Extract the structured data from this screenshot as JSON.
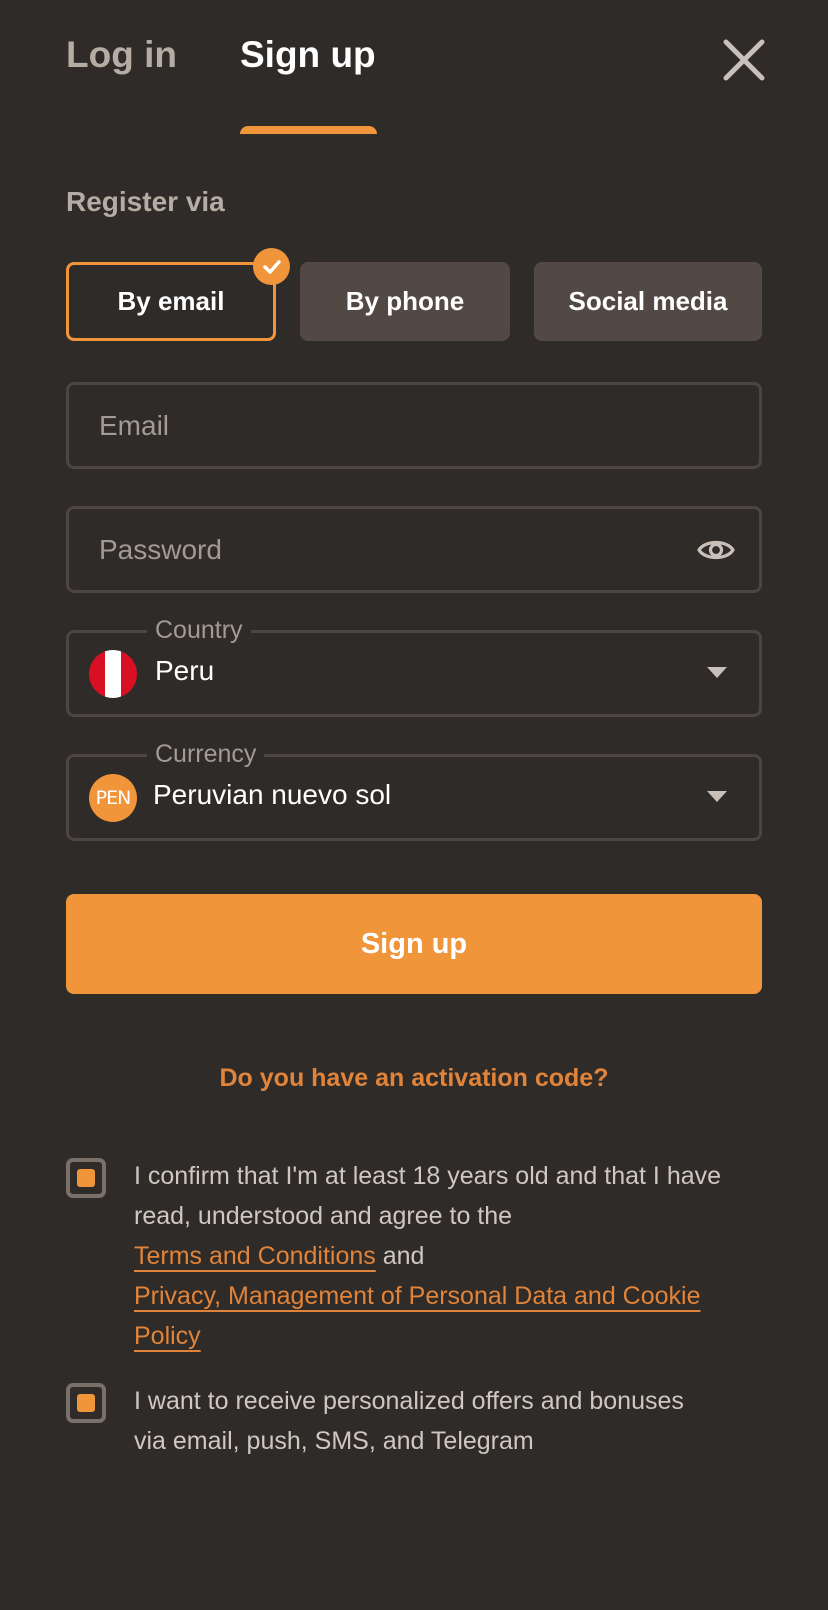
{
  "tabs": {
    "login": "Log in",
    "signup": "Sign up"
  },
  "register_via": "Register via",
  "methods": {
    "email": "By email",
    "phone": "By phone",
    "social": "Social media"
  },
  "fields": {
    "email_placeholder": "Email",
    "password_placeholder": "Password",
    "country_label": "Country",
    "country_value": "Peru",
    "currency_label": "Currency",
    "currency_code": "PEN",
    "currency_value": "Peruvian nuevo sol"
  },
  "submit_label": "Sign up",
  "activation_link": "Do you have an activation code?",
  "consent": {
    "line1": "I confirm that I'm at least 18 years old and that I have",
    "line2": "read, understood and agree to the",
    "terms_link": "Terms and Conditions",
    "and_text": " and",
    "privacy_link_1": "Privacy, Management of Personal Data and Cookie",
    "privacy_link_2": "Policy",
    "checked": true
  },
  "offers": {
    "line1": "I want to receive personalized offers and bonuses",
    "line2": "via email, push, SMS, and Telegram",
    "checked": true
  },
  "colors": {
    "background": "#2e2b29",
    "accent": "#f0953a",
    "muted_text": "#b5aca4",
    "button_bg": "#524945"
  }
}
